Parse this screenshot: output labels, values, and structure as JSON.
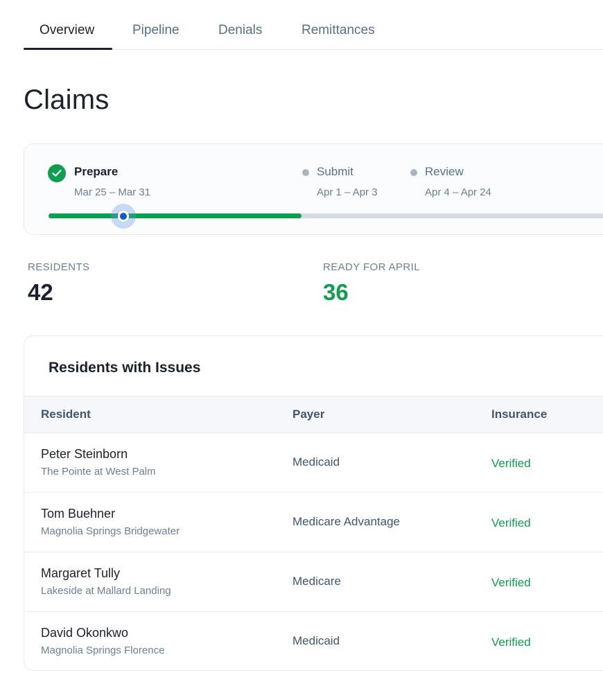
{
  "tabs": [
    {
      "label": "Overview",
      "active": true
    },
    {
      "label": "Pipeline",
      "active": false
    },
    {
      "label": "Denials",
      "active": false
    },
    {
      "label": "Remittances",
      "active": false
    }
  ],
  "page": {
    "title": "Claims"
  },
  "timeline": {
    "steps": [
      {
        "title": "Prepare",
        "dates": "Mar 25 – Mar 31",
        "status": "complete",
        "icon": "check-icon"
      },
      {
        "title": "Submit",
        "dates": "Apr 1 – Apr 3",
        "status": "upcoming"
      },
      {
        "title": "Review",
        "dates": "Apr 4 – Apr 24",
        "status": "upcoming"
      }
    ],
    "progress_fraction": 0.44,
    "handle_fraction": 0.13
  },
  "stats": {
    "residents": {
      "label": "RESIDENTS",
      "value": "42"
    },
    "ready": {
      "label": "READY FOR APRIL",
      "value": "36"
    }
  },
  "issues": {
    "title": "Residents with Issues",
    "columns": [
      "Resident",
      "Payer",
      "Insurance"
    ],
    "rows": [
      {
        "name": "Peter Steinborn",
        "facility": "The Pointe at West Palm",
        "payer": "Medicaid",
        "insurance": "Verified"
      },
      {
        "name": "Tom Buehner",
        "facility": "Magnolia Springs Bridgewater",
        "payer": "Medicare Advantage",
        "insurance": "Verified"
      },
      {
        "name": "Margaret Tully",
        "facility": "Lakeside at Mallard Landing",
        "payer": "Medicare",
        "insurance": "Verified"
      },
      {
        "name": "David Okonkwo",
        "facility": "Magnolia Springs Florence",
        "payer": "Medicaid",
        "insurance": "Verified"
      }
    ]
  },
  "colors": {
    "accent_green": "#0f9d4f",
    "handle_blue": "#1459c4",
    "text_dark": "#1c2130",
    "text_muted": "#6b7f98"
  }
}
